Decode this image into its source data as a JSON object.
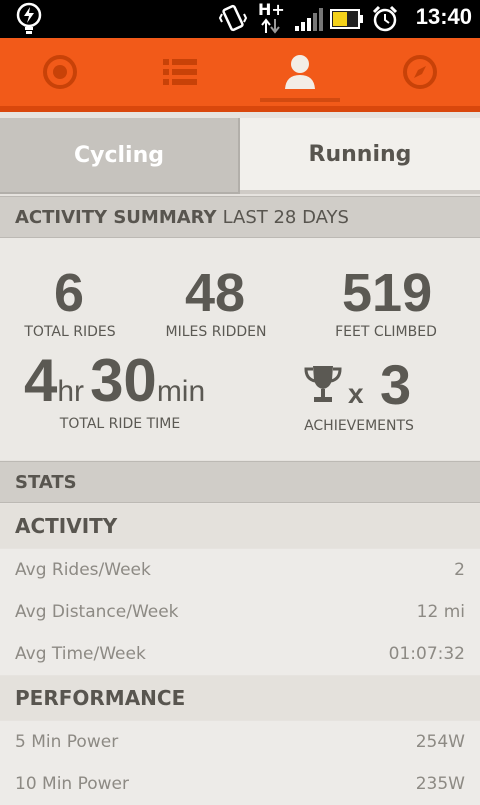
{
  "statusbar": {
    "time": "13:40",
    "network": "H+"
  },
  "nav": {
    "items": [
      {
        "icon": "record-icon"
      },
      {
        "icon": "list-icon"
      },
      {
        "icon": "profile-icon"
      },
      {
        "icon": "compass-icon"
      }
    ],
    "active": 2
  },
  "tabs": {
    "cycling": "Cycling",
    "running": "Running",
    "active": "cycling"
  },
  "summary": {
    "header_bold": "ACTIVITY SUMMARY",
    "header_rest": "LAST 28 DAYS",
    "total_rides": {
      "value": "6",
      "label": "TOTAL RIDES"
    },
    "miles_ridden": {
      "value": "48",
      "label": "MILES RIDDEN"
    },
    "feet_climbed": {
      "value": "519",
      "label": "FEET CLIMBED"
    },
    "ride_time": {
      "hours": "4",
      "hours_unit": "hr",
      "minutes": "30",
      "minutes_unit": "min",
      "label": "TOTAL RIDE TIME"
    },
    "achievements": {
      "x": "x",
      "value": "3",
      "label": "ACHIEVEMENTS"
    }
  },
  "stats": {
    "header": "STATS",
    "activity": {
      "title": "ACTIVITY",
      "rows": [
        {
          "label": "Avg Rides/Week",
          "value": "2"
        },
        {
          "label": "Avg Distance/Week",
          "value": "12 mi"
        },
        {
          "label": "Avg Time/Week",
          "value": "01:07:32"
        }
      ]
    },
    "performance": {
      "title": "PERFORMANCE",
      "rows": [
        {
          "label": "5 Min Power",
          "value": "254W"
        },
        {
          "label": "10 Min Power",
          "value": "235W"
        }
      ]
    }
  },
  "colors": {
    "accent": "#f25a19",
    "accent_dark": "#d9470c",
    "text": "#5b5953"
  }
}
